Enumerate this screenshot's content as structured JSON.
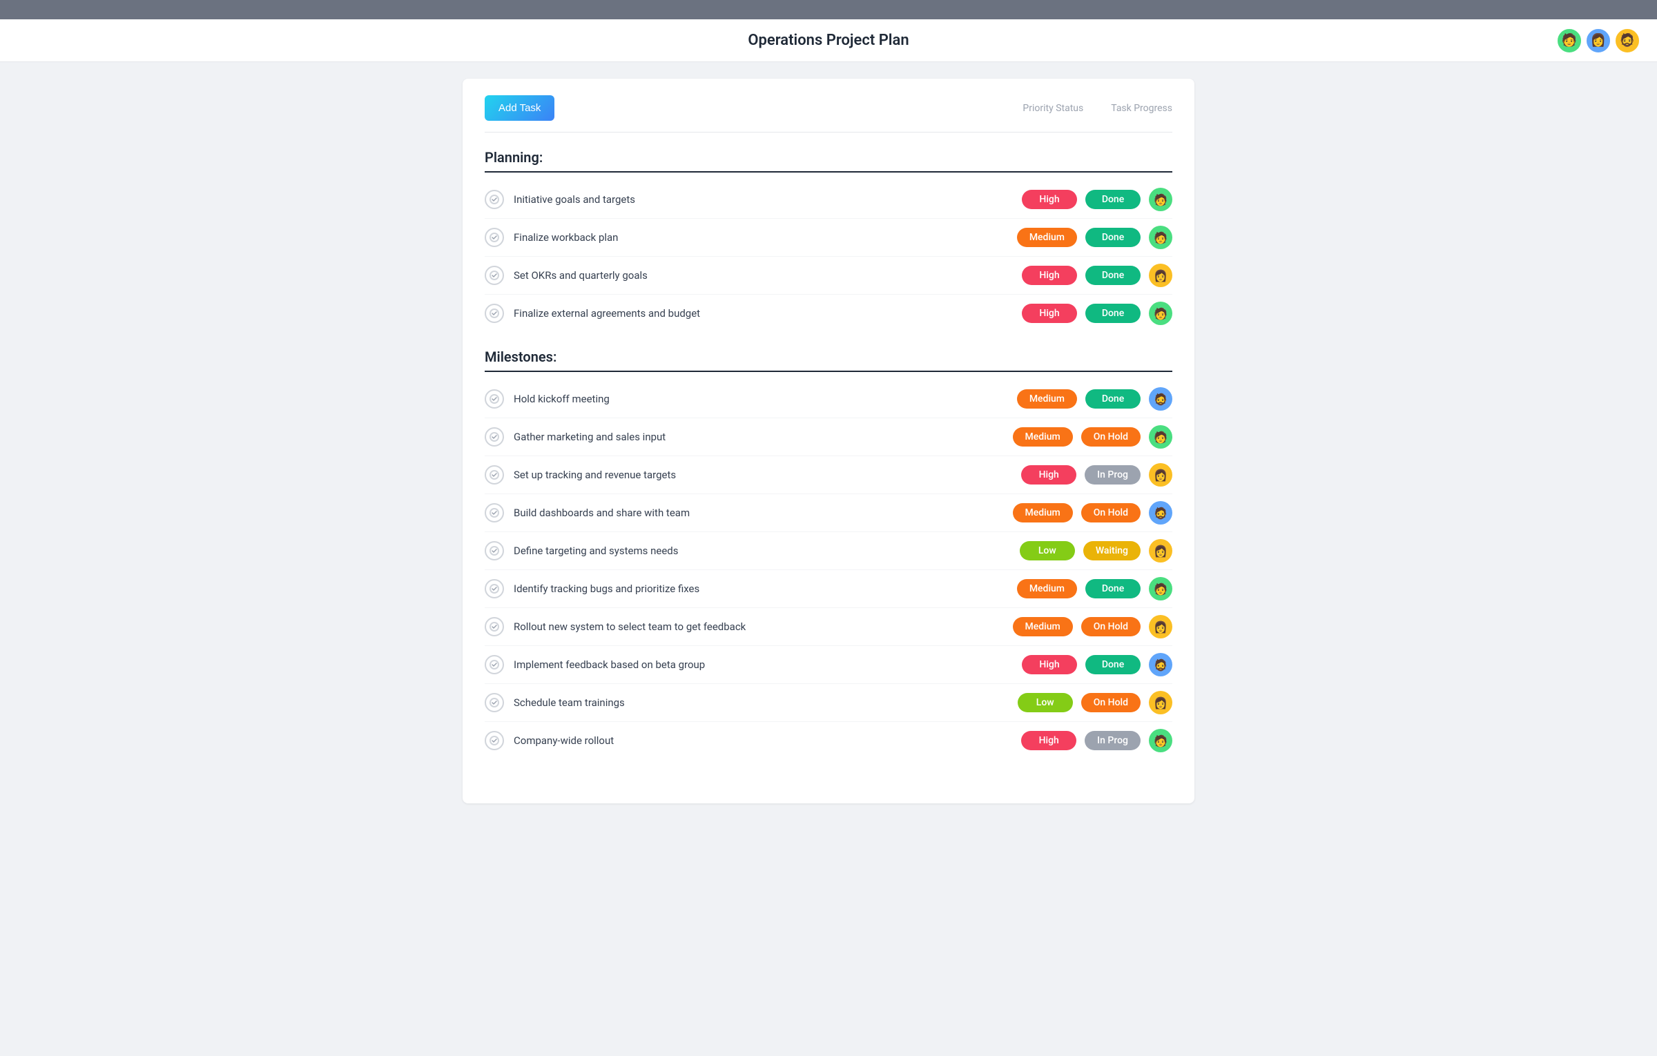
{
  "topbar": {},
  "header": {
    "title": "Operations Project Plan",
    "avatars": [
      {
        "id": "avatar-1",
        "color": "av-green",
        "emoji": "🧑"
      },
      {
        "id": "avatar-2",
        "color": "av-blue",
        "emoji": "👩"
      },
      {
        "id": "avatar-3",
        "color": "av-yellow",
        "emoji": "🧔"
      }
    ]
  },
  "toolbar": {
    "add_task_label": "Add Task",
    "col1_label": "Priority Status",
    "col2_label": "Task Progress"
  },
  "sections": [
    {
      "id": "planning",
      "title": "Planning:",
      "tasks": [
        {
          "name": "Initiative goals and targets",
          "priority": "High",
          "priority_class": "priority-high",
          "status": "Done",
          "status_class": "status-done",
          "avatar_class": "av-green",
          "avatar_emoji": "🧑"
        },
        {
          "name": "Finalize workback plan",
          "priority": "Medium",
          "priority_class": "priority-medium",
          "status": "Done",
          "status_class": "status-done",
          "avatar_class": "av-green",
          "avatar_emoji": "🧑"
        },
        {
          "name": "Set OKRs and quarterly goals",
          "priority": "High",
          "priority_class": "priority-high",
          "status": "Done",
          "status_class": "status-done",
          "avatar_class": "av-yellow",
          "avatar_emoji": "👩"
        },
        {
          "name": "Finalize external agreements and budget",
          "priority": "High",
          "priority_class": "priority-high",
          "status": "Done",
          "status_class": "status-done",
          "avatar_class": "av-green",
          "avatar_emoji": "🧑"
        }
      ]
    },
    {
      "id": "milestones",
      "title": "Milestones:",
      "tasks": [
        {
          "name": "Hold kickoff meeting",
          "priority": "Medium",
          "priority_class": "priority-medium",
          "status": "Done",
          "status_class": "status-done",
          "avatar_class": "av-blue",
          "avatar_emoji": "🧔"
        },
        {
          "name": "Gather marketing and sales input",
          "priority": "Medium",
          "priority_class": "priority-medium",
          "status": "On Hold",
          "status_class": "status-onhold",
          "avatar_class": "av-green",
          "avatar_emoji": "🧑"
        },
        {
          "name": "Set up tracking and revenue targets",
          "priority": "High",
          "priority_class": "priority-high",
          "status": "In Prog",
          "status_class": "status-inprog",
          "avatar_class": "av-yellow",
          "avatar_emoji": "👩"
        },
        {
          "name": "Build dashboards and share with team",
          "priority": "Medium",
          "priority_class": "priority-medium",
          "status": "On Hold",
          "status_class": "status-onhold",
          "avatar_class": "av-blue",
          "avatar_emoji": "🧔"
        },
        {
          "name": "Define targeting and systems needs",
          "priority": "Low",
          "priority_class": "priority-low",
          "status": "Waiting",
          "status_class": "status-waiting",
          "avatar_class": "av-yellow",
          "avatar_emoji": "👩"
        },
        {
          "name": "Identify tracking bugs and prioritize fixes",
          "priority": "Medium",
          "priority_class": "priority-medium",
          "status": "Done",
          "status_class": "status-done",
          "avatar_class": "av-green",
          "avatar_emoji": "🧑"
        },
        {
          "name": "Rollout new system to select team to get feedback",
          "priority": "Medium",
          "priority_class": "priority-medium",
          "status": "On Hold",
          "status_class": "status-onhold",
          "avatar_class": "av-yellow",
          "avatar_emoji": "👩"
        },
        {
          "name": "Implement feedback based on beta group",
          "priority": "High",
          "priority_class": "priority-high",
          "status": "Done",
          "status_class": "status-done",
          "avatar_class": "av-blue",
          "avatar_emoji": "🧔"
        },
        {
          "name": "Schedule team trainings",
          "priority": "Low",
          "priority_class": "priority-low",
          "status": "On Hold",
          "status_class": "status-onhold",
          "avatar_class": "av-yellow",
          "avatar_emoji": "👩"
        },
        {
          "name": "Company-wide rollout",
          "priority": "High",
          "priority_class": "priority-high",
          "status": "In Prog",
          "status_class": "status-inprog",
          "avatar_class": "av-green",
          "avatar_emoji": "🧑"
        }
      ]
    }
  ]
}
